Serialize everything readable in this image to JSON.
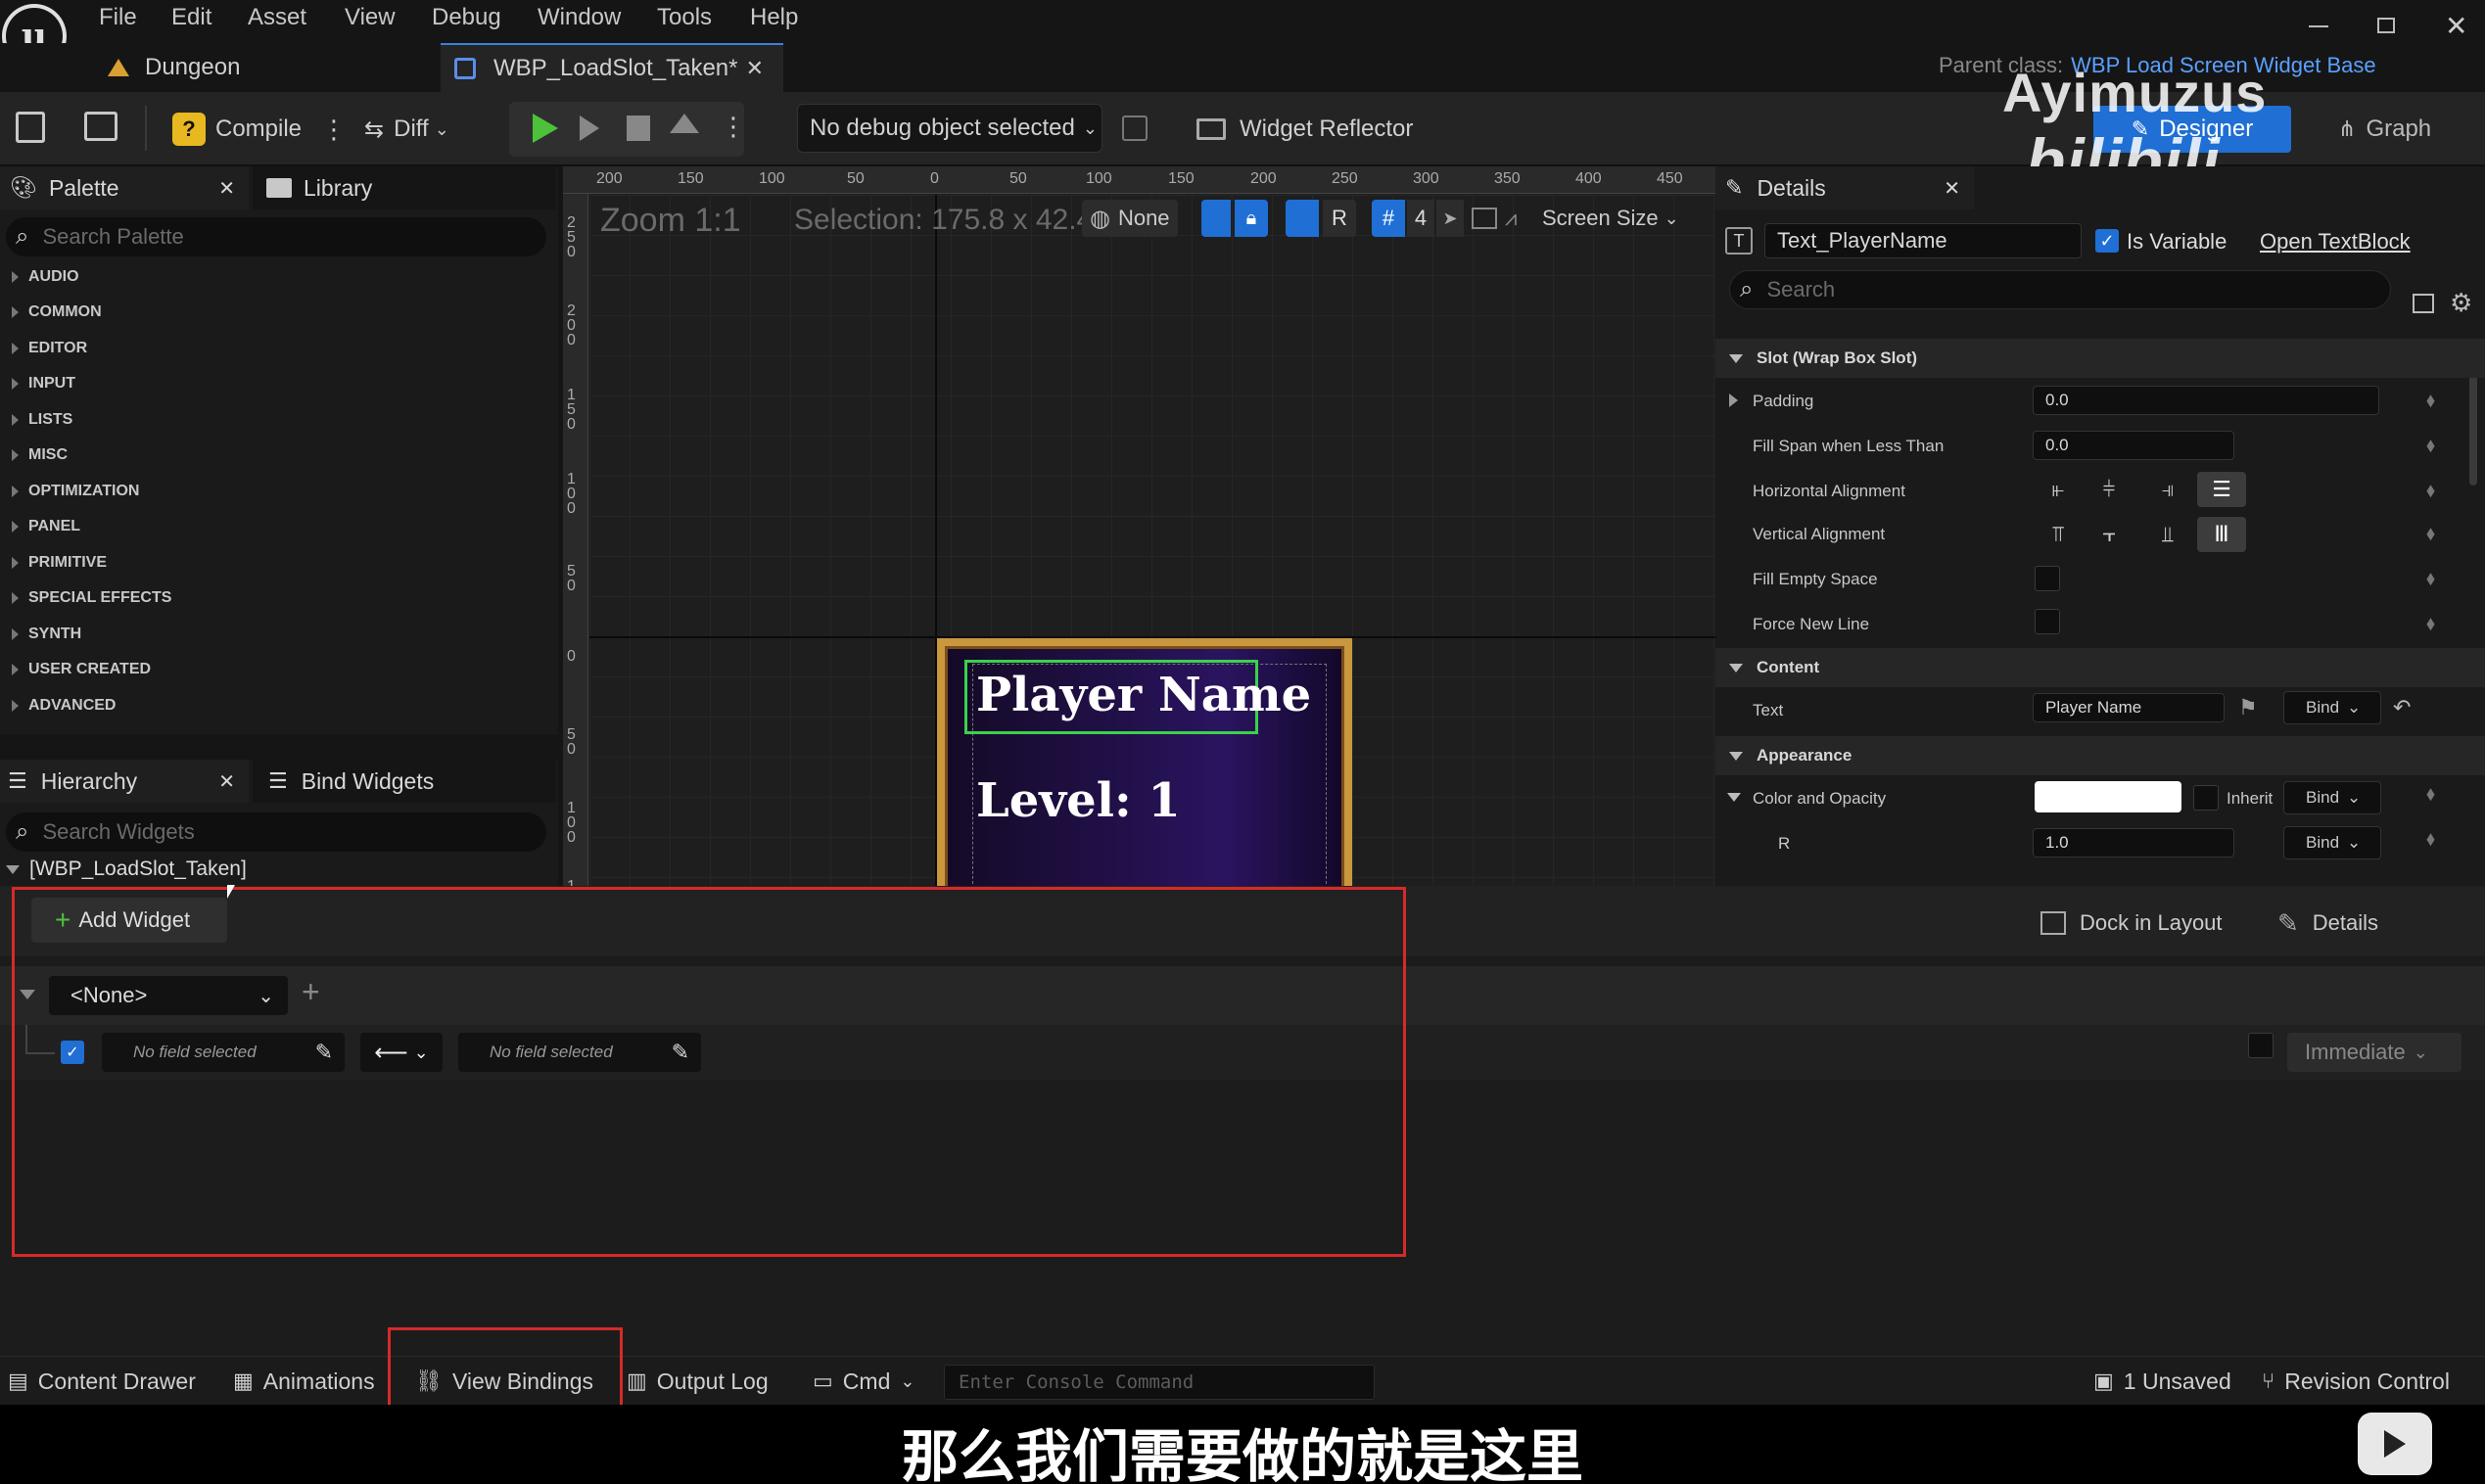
{
  "menu": [
    "File",
    "Edit",
    "Asset",
    "View",
    "Debug",
    "Window",
    "Tools",
    "Help"
  ],
  "tabs": {
    "project": "Dungeon",
    "asset": "WBP_LoadSlot_Taken*"
  },
  "parent_class": {
    "label": "Parent class:",
    "value": "WBP Load Screen Widget Base"
  },
  "watermark": {
    "author": "Ayimuzus",
    "site": "bilibili"
  },
  "mode_buttons": {
    "designer": "Designer",
    "graph": "Graph"
  },
  "toolbar": {
    "compile": "Compile",
    "diff": "Diff",
    "debug_object": "No debug object selected",
    "reflector": "Widget Reflector"
  },
  "palette": {
    "title": "Palette",
    "library": "Library",
    "search_placeholder": "Search Palette",
    "categories": [
      "AUDIO",
      "COMMON",
      "EDITOR",
      "INPUT",
      "LISTS",
      "MISC",
      "OPTIMIZATION",
      "PANEL",
      "PRIMITIVE",
      "SPECIAL EFFECTS",
      "SYNTH",
      "USER CREATED",
      "ADVANCED"
    ]
  },
  "hierarchy": {
    "title": "Hierarchy",
    "bind_widgets": "Bind Widgets",
    "search_placeholder": "Search Widgets",
    "root": "[WBP_LoadSlot_Taken]"
  },
  "viewport": {
    "zoom": "Zoom 1:1",
    "selection": "Selection: 175.8 x 42.4",
    "world": "None",
    "r": "R",
    "grid": "4",
    "screen_size": "Screen Size",
    "ruler_h": [
      "200",
      "150",
      "100",
      "50",
      "0",
      "50",
      "100",
      "150",
      "200",
      "250",
      "300",
      "350",
      "400",
      "450"
    ],
    "ruler_v": [
      "250",
      "200",
      "150",
      "100",
      "50",
      "0",
      "50",
      "100",
      "1"
    ],
    "player_name": "Player Name",
    "level": "Level: 1"
  },
  "details": {
    "title": "Details",
    "widget_name": "Text_PlayerName",
    "is_variable": "Is Variable",
    "open_link": "Open TextBlock",
    "search_placeholder": "Search",
    "slot_section": "Slot (Wrap Box Slot)",
    "padding_label": "Padding",
    "padding_value": "0.0",
    "fill_span_label": "Fill Span when Less Than",
    "fill_span_value": "0.0",
    "h_align_label": "Horizontal Alignment",
    "v_align_label": "Vertical Alignment",
    "fill_empty_label": "Fill Empty Space",
    "force_new_line_label": "Force New Line",
    "content_section": "Content",
    "text_label": "Text",
    "text_value": "Player Name",
    "bind": "Bind",
    "appearance_section": "Appearance",
    "color_label": "Color and Opacity",
    "inherit": "Inherit",
    "r_label": "R",
    "r_value": "1.0"
  },
  "bindings": {
    "add_widget": "Add Widget",
    "dock": "Dock in Layout",
    "details": "Details",
    "widget_select": "<None>",
    "field_left": "No field selected",
    "field_right": "No field selected",
    "mode": "Immediate"
  },
  "statusbar": {
    "content_drawer": "Content Drawer",
    "animations": "Animations",
    "view_bindings": "View Bindings",
    "output_log": "Output Log",
    "cmd": "Cmd",
    "console_placeholder": "Enter Console Command",
    "unsaved": "1 Unsaved",
    "revision": "Revision Control"
  },
  "subtitle": "那么我们需要做的就是这里"
}
